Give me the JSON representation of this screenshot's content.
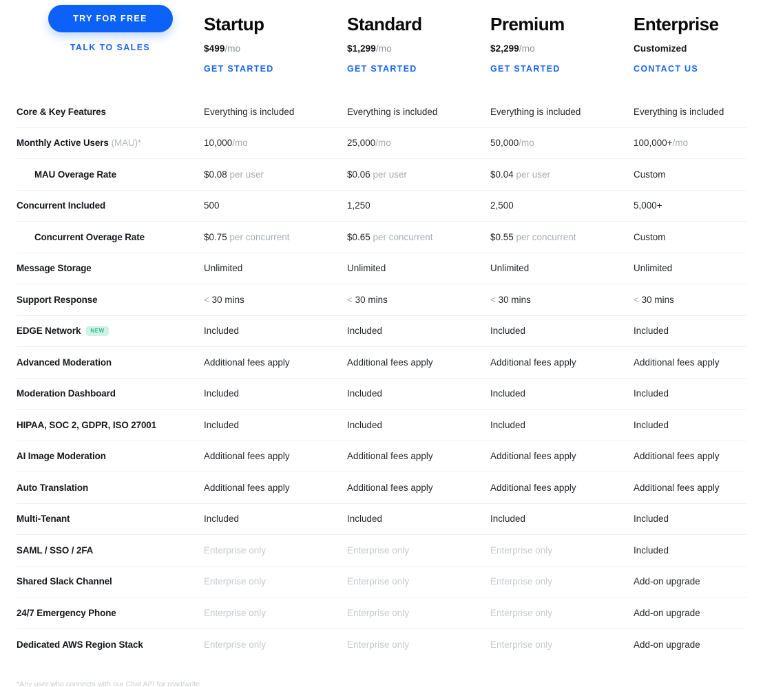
{
  "cta": {
    "primary_label": "TRY FOR FREE",
    "secondary_label": "TALK TO SALES",
    "primary_color": "#0b61f8",
    "link_color": "#1a66f0"
  },
  "plans": [
    {
      "name": "Startup",
      "price": "$499",
      "period": "/mo",
      "action": "GET STARTED"
    },
    {
      "name": "Standard",
      "price": "$1,299",
      "period": "/mo",
      "action": "GET STARTED"
    },
    {
      "name": "Premium",
      "price": "$2,299",
      "period": "/mo",
      "action": "GET STARTED"
    },
    {
      "name": "Enterprise",
      "price": "Customized",
      "period": "",
      "action": "CONTACT US"
    }
  ],
  "badge": {
    "new_label": "NEW",
    "bg": "#cdf3e6",
    "fg": "#35b48c"
  },
  "rows": [
    {
      "feature": "Core & Key Features",
      "note": "",
      "indent": false,
      "badge": false,
      "cells": [
        {
          "main": "Everything is included",
          "sub": "",
          "dim": false
        },
        {
          "main": "Everything is included",
          "sub": "",
          "dim": false
        },
        {
          "main": "Everything is included",
          "sub": "",
          "dim": false
        },
        {
          "main": "Everything is included",
          "sub": "",
          "dim": false
        }
      ]
    },
    {
      "feature": "Monthly Active Users",
      "note": "(MAU)*",
      "indent": false,
      "badge": false,
      "cells": [
        {
          "main": "10,000",
          "sub": "/mo",
          "dim": false
        },
        {
          "main": "25,000",
          "sub": "/mo",
          "dim": false
        },
        {
          "main": "50,000",
          "sub": "/mo",
          "dim": false
        },
        {
          "main": "100,000+",
          "sub": "/mo",
          "dim": false
        }
      ]
    },
    {
      "feature": "MAU Overage Rate",
      "note": "",
      "indent": true,
      "badge": false,
      "cells": [
        {
          "main": "$0.08",
          "sub": " per user",
          "dim": false
        },
        {
          "main": "$0.06",
          "sub": " per user",
          "dim": false
        },
        {
          "main": "$0.04",
          "sub": " per user",
          "dim": false
        },
        {
          "main": "Custom",
          "sub": "",
          "dim": false
        }
      ]
    },
    {
      "feature": "Concurrent Included",
      "note": "",
      "indent": false,
      "badge": false,
      "cells": [
        {
          "main": "500",
          "sub": "",
          "dim": false
        },
        {
          "main": "1,250",
          "sub": "",
          "dim": false
        },
        {
          "main": "2,500",
          "sub": "",
          "dim": false
        },
        {
          "main": "5,000+",
          "sub": "",
          "dim": false
        }
      ]
    },
    {
      "feature": "Concurrent Overage Rate",
      "note": "",
      "indent": true,
      "badge": false,
      "cells": [
        {
          "main": "$0.75",
          "sub": " per concurrent",
          "dim": false
        },
        {
          "main": "$0.65",
          "sub": " per concurrent",
          "dim": false
        },
        {
          "main": "$0.55",
          "sub": " per concurrent",
          "dim": false
        },
        {
          "main": "Custom",
          "sub": "",
          "dim": false
        }
      ]
    },
    {
      "feature": "Message Storage",
      "note": "",
      "indent": false,
      "badge": false,
      "cells": [
        {
          "main": "Unlimited",
          "sub": "",
          "dim": false
        },
        {
          "main": "Unlimited",
          "sub": "",
          "dim": false
        },
        {
          "main": "Unlimited",
          "sub": "",
          "dim": false
        },
        {
          "main": "Unlimited",
          "sub": "",
          "dim": false
        }
      ]
    },
    {
      "feature": "Support Response",
      "note": "",
      "indent": false,
      "badge": false,
      "cells": [
        {
          "pre": "< ",
          "main": "30 mins",
          "sub": "",
          "dim": false
        },
        {
          "pre": "< ",
          "main": "30 mins",
          "sub": "",
          "dim": false
        },
        {
          "pre": "< ",
          "main": "30 mins",
          "sub": "",
          "dim": false
        },
        {
          "pre": "< ",
          "main": "30 mins",
          "sub": "",
          "dim": false
        }
      ]
    },
    {
      "feature": "EDGE Network",
      "note": "",
      "indent": false,
      "badge": true,
      "cells": [
        {
          "main": "Included",
          "sub": "",
          "dim": false
        },
        {
          "main": "Included",
          "sub": "",
          "dim": false
        },
        {
          "main": "Included",
          "sub": "",
          "dim": false
        },
        {
          "main": "Included",
          "sub": "",
          "dim": false
        }
      ]
    },
    {
      "feature": "Advanced Moderation",
      "note": "",
      "indent": false,
      "badge": false,
      "cells": [
        {
          "main": "Additional fees apply",
          "sub": "",
          "dim": false
        },
        {
          "main": "Additional fees apply",
          "sub": "",
          "dim": false
        },
        {
          "main": "Additional fees apply",
          "sub": "",
          "dim": false
        },
        {
          "main": "Additional fees apply",
          "sub": "",
          "dim": false
        }
      ]
    },
    {
      "feature": "Moderation Dashboard",
      "note": "",
      "indent": false,
      "badge": false,
      "cells": [
        {
          "main": "Included",
          "sub": "",
          "dim": false
        },
        {
          "main": "Included",
          "sub": "",
          "dim": false
        },
        {
          "main": "Included",
          "sub": "",
          "dim": false
        },
        {
          "main": "Included",
          "sub": "",
          "dim": false
        }
      ]
    },
    {
      "feature": "HIPAA, SOC 2, GDPR, ISO 27001",
      "note": "",
      "indent": false,
      "badge": false,
      "cells": [
        {
          "main": "Included",
          "sub": "",
          "dim": false
        },
        {
          "main": "Included",
          "sub": "",
          "dim": false
        },
        {
          "main": "Included",
          "sub": "",
          "dim": false
        },
        {
          "main": "Included",
          "sub": "",
          "dim": false
        }
      ]
    },
    {
      "feature": "AI Image Moderation",
      "note": "",
      "indent": false,
      "badge": false,
      "cells": [
        {
          "main": "Additional fees apply",
          "sub": "",
          "dim": false
        },
        {
          "main": "Additional fees apply",
          "sub": "",
          "dim": false
        },
        {
          "main": "Additional fees apply",
          "sub": "",
          "dim": false
        },
        {
          "main": "Additional fees apply",
          "sub": "",
          "dim": false
        }
      ]
    },
    {
      "feature": "Auto Translation",
      "note": "",
      "indent": false,
      "badge": false,
      "cells": [
        {
          "main": "Additional fees apply",
          "sub": "",
          "dim": false
        },
        {
          "main": "Additional fees apply",
          "sub": "",
          "dim": false
        },
        {
          "main": "Additional fees apply",
          "sub": "",
          "dim": false
        },
        {
          "main": "Additional fees apply",
          "sub": "",
          "dim": false
        }
      ]
    },
    {
      "feature": "Multi-Tenant",
      "note": "",
      "indent": false,
      "badge": false,
      "cells": [
        {
          "main": "Included",
          "sub": "",
          "dim": false
        },
        {
          "main": "Included",
          "sub": "",
          "dim": false
        },
        {
          "main": "Included",
          "sub": "",
          "dim": false
        },
        {
          "main": "Included",
          "sub": "",
          "dim": false
        }
      ]
    },
    {
      "feature": "SAML / SSO / 2FA",
      "note": "",
      "indent": false,
      "badge": false,
      "cells": [
        {
          "main": "Enterprise only",
          "sub": "",
          "dim": true
        },
        {
          "main": "Enterprise only",
          "sub": "",
          "dim": true
        },
        {
          "main": "Enterprise only",
          "sub": "",
          "dim": true
        },
        {
          "main": "Included",
          "sub": "",
          "dim": false
        }
      ]
    },
    {
      "feature": "Shared Slack Channel",
      "note": "",
      "indent": false,
      "badge": false,
      "cells": [
        {
          "main": "Enterprise only",
          "sub": "",
          "dim": true
        },
        {
          "main": "Enterprise only",
          "sub": "",
          "dim": true
        },
        {
          "main": "Enterprise only",
          "sub": "",
          "dim": true
        },
        {
          "main": "Add-on upgrade",
          "sub": "",
          "dim": false
        }
      ]
    },
    {
      "feature": "24/7 Emergency Phone",
      "note": "",
      "indent": false,
      "badge": false,
      "cells": [
        {
          "main": "Enterprise only",
          "sub": "",
          "dim": true
        },
        {
          "main": "Enterprise only",
          "sub": "",
          "dim": true
        },
        {
          "main": "Enterprise only",
          "sub": "",
          "dim": true
        },
        {
          "main": "Add-on upgrade",
          "sub": "",
          "dim": false
        }
      ]
    },
    {
      "feature": "Dedicated AWS Region Stack",
      "note": "",
      "indent": false,
      "badge": false,
      "cells": [
        {
          "main": "Enterprise only",
          "sub": "",
          "dim": true
        },
        {
          "main": "Enterprise only",
          "sub": "",
          "dim": true
        },
        {
          "main": "Enterprise only",
          "sub": "",
          "dim": true
        },
        {
          "main": "Add-on upgrade",
          "sub": "",
          "dim": false
        }
      ]
    }
  ],
  "footnote": "*Any user who connects with our Chat API for read/write"
}
